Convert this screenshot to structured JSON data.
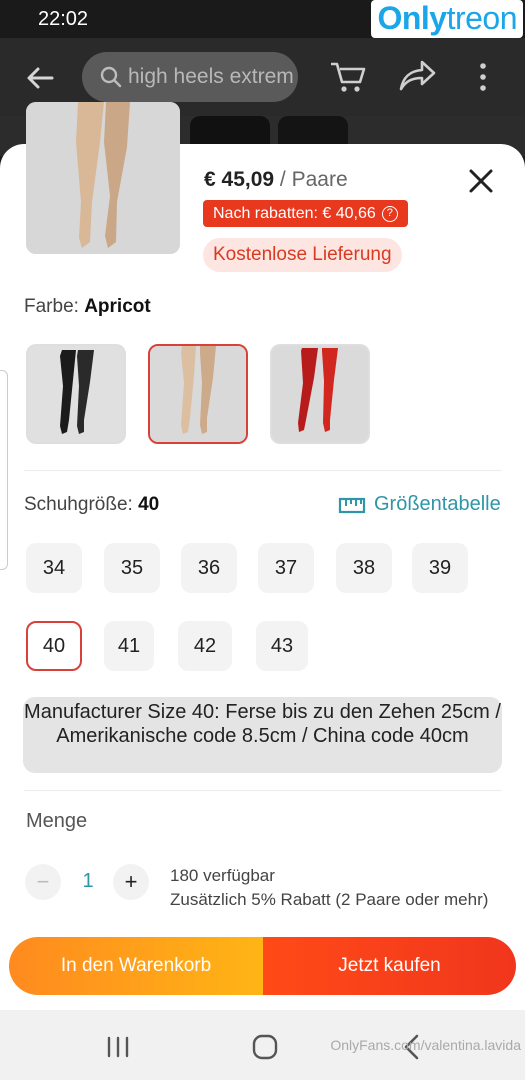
{
  "status": {
    "time": "22:02"
  },
  "brand": {
    "part1": "Only",
    "part2": "treon"
  },
  "appbar": {
    "search_query": "high heels extrem"
  },
  "product": {
    "price": "€ 45,09",
    "unit": "/ Paare",
    "discount_text": "Nach rabatten: € 40,66",
    "shipping_text": "Kostenlose Lieferung"
  },
  "color": {
    "label": "Farbe:",
    "selected": "Apricot",
    "swatches": [
      {
        "name": "black",
        "boot": "#1b1b1b"
      },
      {
        "name": "apricot",
        "boot": "#d9b99a"
      },
      {
        "name": "red",
        "boot": "#c4201d"
      }
    ]
  },
  "size": {
    "label": "Schuhgröße:",
    "selected": "40",
    "chart_label": "Größentabelle",
    "options": [
      "34",
      "35",
      "36",
      "37",
      "38",
      "39",
      "40",
      "41",
      "42",
      "43"
    ],
    "note": "Manufacturer Size 40: Ferse bis zu den Zehen 25cm / Amerikanische code 8.5cm / China code 40cm"
  },
  "quantity": {
    "label": "Menge",
    "value": "1",
    "minus": "−",
    "plus": "+",
    "stock": "180 verfügbar",
    "promo": "Zusätzlich 5% Rabatt (2 Paare oder mehr)"
  },
  "actions": {
    "add_to_cart": "In den Warenkorb",
    "buy_now": "Jetzt kaufen"
  },
  "watermark": "OnlyFans.com/valentina.lavida",
  "colors": {
    "accent_red": "#e8381e",
    "teal": "#2f96a8",
    "orange": "#ff9a1c"
  }
}
